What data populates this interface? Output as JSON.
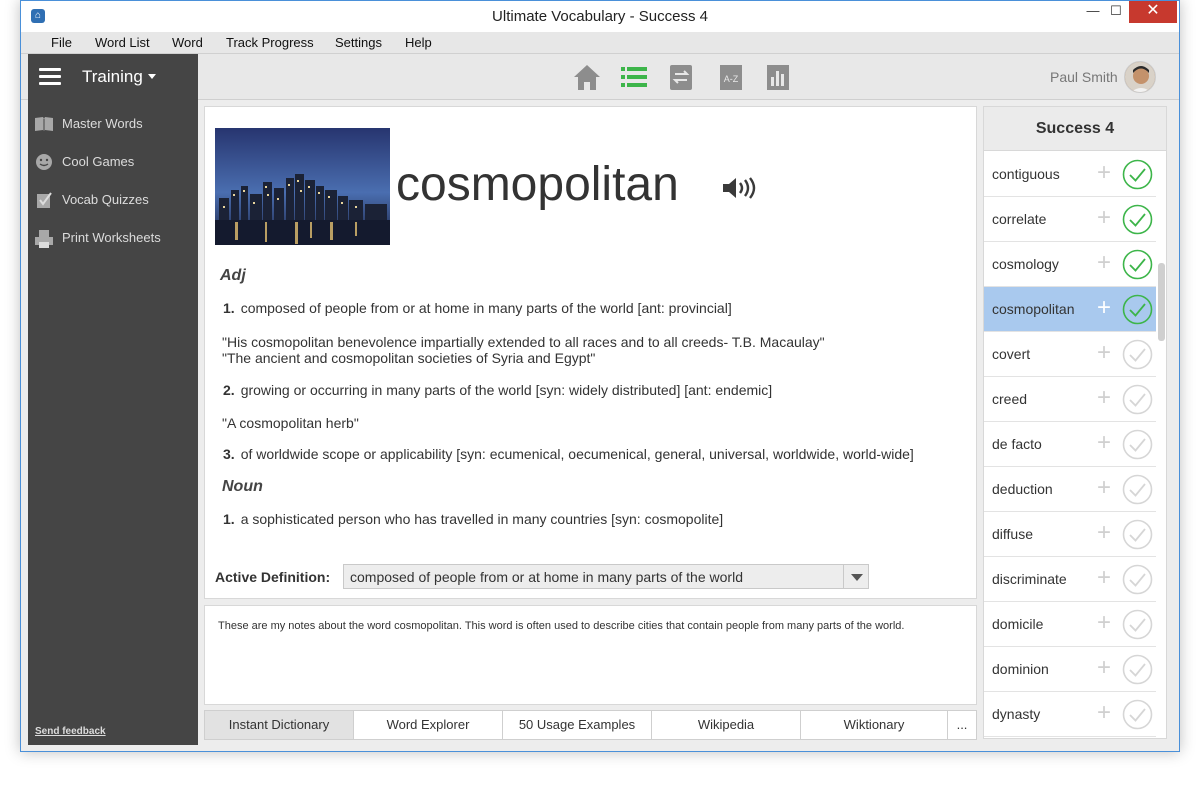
{
  "window": {
    "title": "Ultimate Vocabulary - Success 4",
    "minimize": "—",
    "maximize": "☐",
    "close": "✕"
  },
  "menu": [
    "File",
    "Word List",
    "Word",
    "Track Progress",
    "Settings",
    "Help"
  ],
  "sidebar": {
    "mode_label": "Training",
    "items": [
      {
        "label": "Master Words",
        "icon": "book-icon"
      },
      {
        "label": "Cool Games",
        "icon": "smiley-icon"
      },
      {
        "label": "Vocab Quizzes",
        "icon": "quiz-icon"
      },
      {
        "label": "Print Worksheets",
        "icon": "printer-icon"
      }
    ],
    "feedback": "Send feedback"
  },
  "toolbar": {
    "icons": [
      "home-icon",
      "list-icon",
      "flashcards-icon",
      "az-icon",
      "chart-icon"
    ],
    "az_text": "A-Z",
    "user_name": "Paul Smith",
    "accent": "#3db54a"
  },
  "definition": {
    "word": "cosmopolitan",
    "sections": [
      {
        "pos": "Adj",
        "senses": [
          {
            "num": "1.",
            "text": "composed of people from or at home in many parts of the world [ant: provincial]",
            "examples": [
              "\"His cosmopolitan benevolence impartially extended to all races and to all creeds- T.B. Macaulay\"",
              "\"The ancient and cosmopolitan societies of Syria and Egypt\""
            ]
          },
          {
            "num": "2.",
            "text": "growing or occurring in many parts of the world [syn: widely distributed] [ant: endemic]",
            "examples": [
              "\"A cosmopolitan herb\""
            ]
          },
          {
            "num": "3.",
            "text": "of worldwide scope or applicability [syn: ecumenical, oecumenical, general, universal, worldwide, world-wide]",
            "examples": []
          }
        ]
      },
      {
        "pos": "Noun",
        "senses": [
          {
            "num": "1.",
            "text": "a sophisticated person who has travelled in many countries [syn: cosmopolite]",
            "examples": []
          }
        ]
      }
    ],
    "active_label": "Active Definition:",
    "active_value": "composed of people from or at home in many parts of the world"
  },
  "notes": "These are my notes about the word cosmopolitan. This word is often used to describe cities that contain people from many parts of the world.",
  "tabs": [
    "Instant Dictionary",
    "Word Explorer",
    "50 Usage Examples",
    "Wikipedia",
    "Wiktionary",
    "..."
  ],
  "word_list": {
    "title": "Success 4",
    "items": [
      {
        "word": "contiguous",
        "mastered": true
      },
      {
        "word": "correlate",
        "mastered": true
      },
      {
        "word": "cosmology",
        "mastered": true
      },
      {
        "word": "cosmopolitan",
        "mastered": true,
        "selected": true
      },
      {
        "word": "covert",
        "mastered": false
      },
      {
        "word": "creed",
        "mastered": false
      },
      {
        "word": "de facto",
        "mastered": false
      },
      {
        "word": "deduction",
        "mastered": false
      },
      {
        "word": "diffuse",
        "mastered": false
      },
      {
        "word": "discriminate",
        "mastered": false
      },
      {
        "word": "domicile",
        "mastered": false
      },
      {
        "word": "dominion",
        "mastered": false
      },
      {
        "word": "dynasty",
        "mastered": false
      }
    ],
    "plus": "+"
  }
}
